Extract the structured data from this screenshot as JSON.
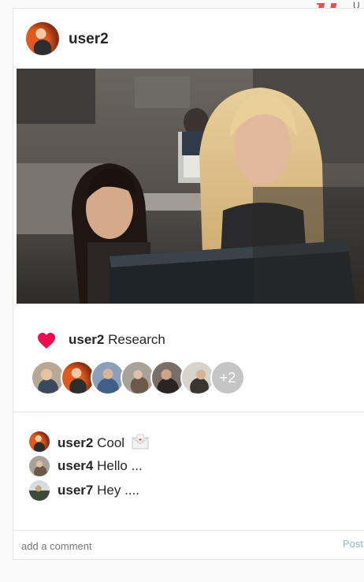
{
  "brand": {
    "logo_glyph": "u",
    "tail_glyph": "U"
  },
  "post": {
    "author": "user2",
    "photo_icon": "office-photo",
    "likes": {
      "icon": "heart-icon",
      "username": "user2",
      "caption": "Research"
    },
    "liker_count_more": "+2",
    "comments": [
      {
        "username": "user2",
        "text": "Cool",
        "emoji": "envelope-emoji"
      },
      {
        "username": "user4",
        "text": "Hello ..."
      },
      {
        "username": "user7",
        "text": "Hey ...."
      }
    ],
    "comment_box": {
      "placeholder": "add a comment",
      "value": ""
    },
    "post_label": "Post"
  },
  "colors": {
    "heart": "#ed0c4e",
    "post_button": "#8fb3dc",
    "brand": "#e1504a"
  }
}
